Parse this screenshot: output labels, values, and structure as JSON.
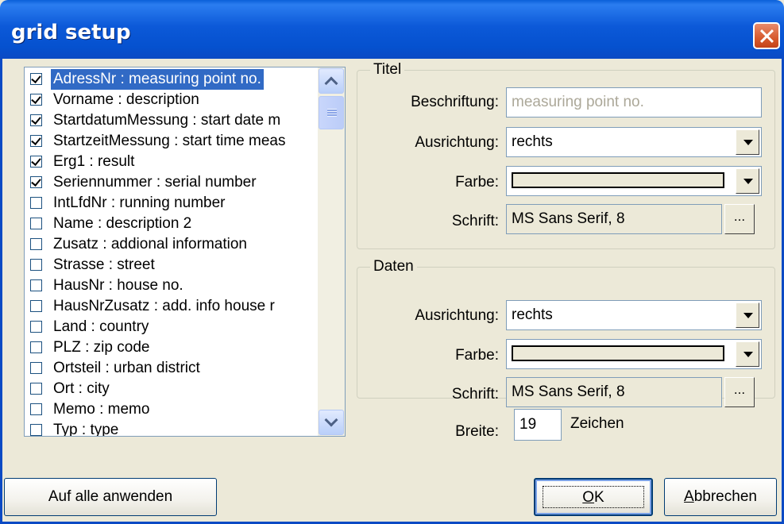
{
  "window": {
    "title": "grid setup"
  },
  "fields": [
    {
      "label": "AdressNr  :  measuring point no.",
      "checked": true,
      "selected": true
    },
    {
      "label": "Vorname  :  description",
      "checked": true
    },
    {
      "label": "StartdatumMessung  :  start date m",
      "checked": true
    },
    {
      "label": "StartzeitMessung  :  start time meas",
      "checked": true
    },
    {
      "label": "Erg1  :  result",
      "checked": true
    },
    {
      "label": "Seriennummer  :  serial number",
      "checked": true
    },
    {
      "label": "IntLfdNr  :  running number",
      "checked": false
    },
    {
      "label": "Name  :  description 2",
      "checked": false
    },
    {
      "label": "Zusatz  :  addional information",
      "checked": false
    },
    {
      "label": "Strasse  :  street",
      "checked": false
    },
    {
      "label": "HausNr  :  house no.",
      "checked": false
    },
    {
      "label": "HausNrZusatz  :  add. info house r",
      "checked": false
    },
    {
      "label": "Land  :  country",
      "checked": false
    },
    {
      "label": "PLZ  :  zip code",
      "checked": false
    },
    {
      "label": "Ortsteil  :  urban district",
      "checked": false
    },
    {
      "label": "Ort  :  city",
      "checked": false
    },
    {
      "label": "Memo  :  memo",
      "checked": false
    },
    {
      "label": "Typ  :  type",
      "checked": false
    }
  ],
  "titel": {
    "group_label": "Titel",
    "caption_label": "Beschriftung:",
    "caption_value": "measuring point no.",
    "align_label": "Ausrichtung:",
    "align_value": "rechts",
    "color_label": "Farbe:",
    "font_label": "Schrift:",
    "font_value": "MS Sans Serif, 8",
    "font_button": "..."
  },
  "daten": {
    "group_label": "Daten",
    "align_label": "Ausrichtung:",
    "align_value": "rechts",
    "color_label": "Farbe:",
    "font_label": "Schrift:",
    "font_value": "MS Sans Serif, 8",
    "font_button": "..."
  },
  "width": {
    "label": "Breite:",
    "value": "19",
    "unit": "Zeichen"
  },
  "buttons": {
    "apply_all": "Auf alle anwenden",
    "ok_mnemonic": "O",
    "ok_rest": "K",
    "cancel_mnemonic": "A",
    "cancel_rest": "bbrechen"
  },
  "colors": {
    "titlebar": "#0551CF",
    "dialog_bg": "#ECE9D8",
    "selection": "#316AC5",
    "close": "#D75A2E"
  }
}
